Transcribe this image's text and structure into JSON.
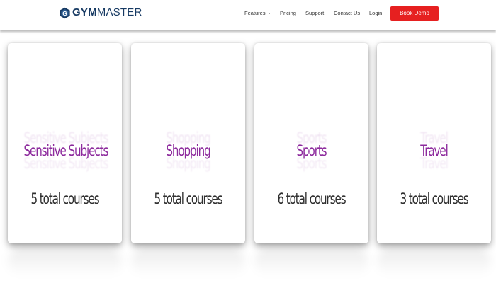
{
  "header": {
    "logo": {
      "brand_strong": "GYM",
      "brand_light": "MASTER",
      "mark_letter": "G"
    },
    "nav": {
      "features": "Features",
      "pricing": "Pricing",
      "support": "Support",
      "contact": "Contact Us",
      "login": "Login"
    },
    "cta": "Book Demo"
  },
  "cards": [
    {
      "title": "Sensitive Subjects",
      "count": "5 total courses"
    },
    {
      "title": "Shopping",
      "count": "5 total courses"
    },
    {
      "title": "Sports",
      "count": "6 total courses"
    },
    {
      "title": "Travel",
      "count": "3 total courses"
    }
  ],
  "colors": {
    "accent": "#e62020",
    "brand": "#173a63",
    "card_title": "#8d2a9d",
    "card_text": "#2f2f2f"
  },
  "icons": {
    "logo_mark": "gymmaster-logo-icon",
    "dropdown": "chevron-down-icon"
  }
}
